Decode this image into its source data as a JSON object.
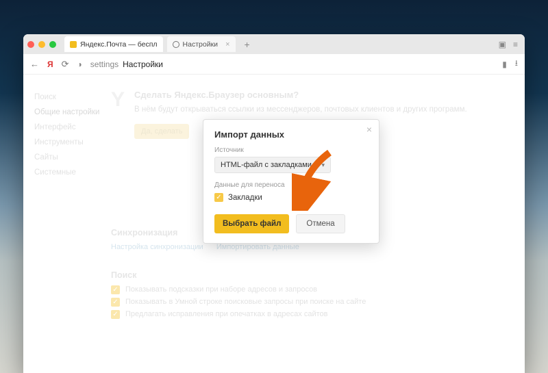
{
  "tabs": {
    "mail": "Яндекс.Почта — беспл",
    "settings": "Настройки"
  },
  "address": {
    "host": "settings",
    "page": "Настройки"
  },
  "sidebar": {
    "items": [
      "Поиск",
      "Общие настройки",
      "Интерфейс",
      "Инструменты",
      "Сайты",
      "Системные"
    ],
    "active_index": 1
  },
  "hero": {
    "title": "Сделать Яндекс.Браузер основным?",
    "desc": "В нём будут открываться ссылки из мессенджеров, почтовых клиентов и других программ.",
    "btn": "Да, сделать"
  },
  "sync": {
    "title": "Синхронизация",
    "link1": "Настройка синхронизации",
    "link2": "Импортировать данные"
  },
  "search": {
    "title": "Поиск",
    "opt1": "Показывать подсказки при наборе адресов и запросов",
    "opt2": "Показывать в Умной строке поисковые запросы при поиске на сайте",
    "opt3": "Предлагать исправления при опечатках в адресах сайтов"
  },
  "dialog": {
    "title": "Импорт данных",
    "source_label": "Источник",
    "source_value": "HTML-файл с закладками",
    "transfer_label": "Данные для переноса",
    "bookmarks": "Закладки",
    "choose": "Выбрать файл",
    "cancel": "Отмена"
  }
}
